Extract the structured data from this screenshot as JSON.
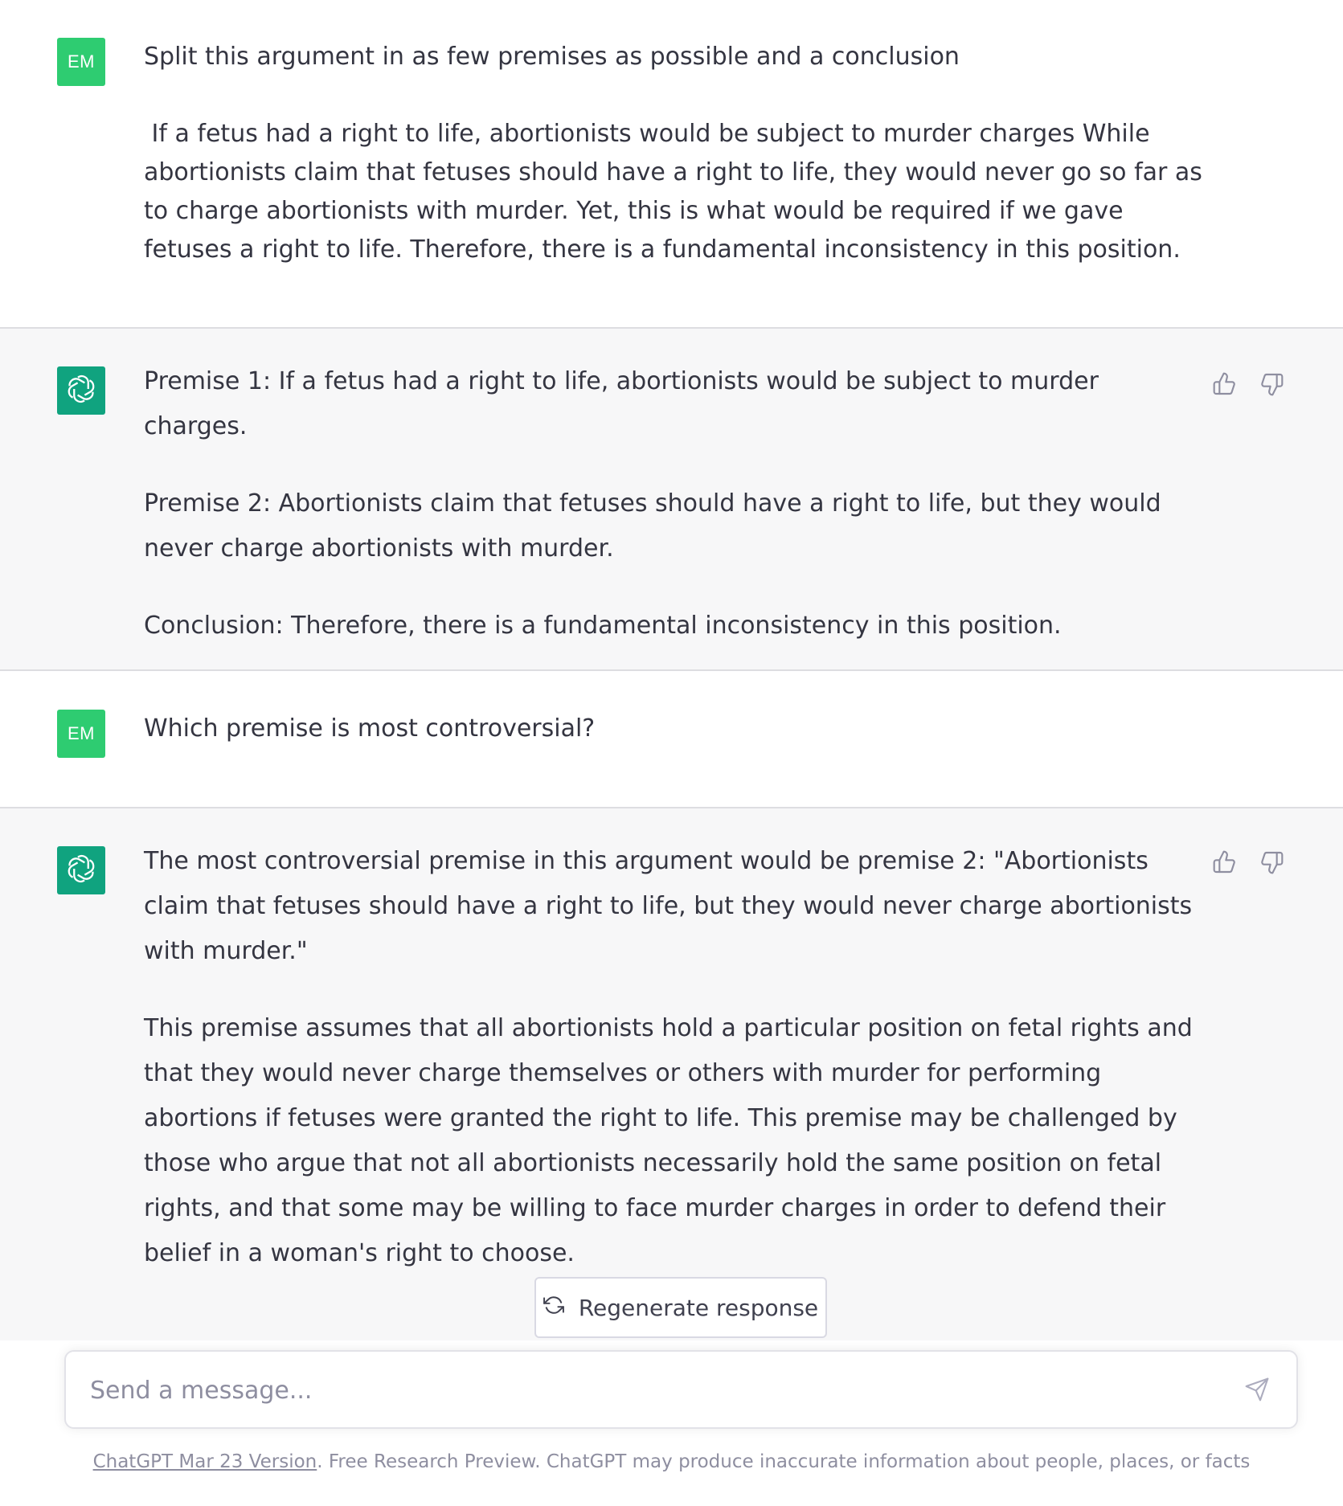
{
  "conversation": {
    "user_avatar_initials": "EM",
    "turns": [
      {
        "role": "user",
        "paragraphs": [
          "Split this argument in as few premises as possible and a conclusion",
          " If a fetus had a right to life, abortionists would be subject to murder charges While abortionists claim that fetuses should have a right to life, they would never go so far as to charge abortionists with murder. Yet, this is what would be required if we gave fetuses a right to life. Therefore, there is a fundamental inconsistency in this position."
        ]
      },
      {
        "role": "assistant",
        "paragraphs": [
          "Premise 1: If a fetus had a right to life, abortionists would be subject to murder charges.",
          "Premise 2: Abortionists claim that fetuses should have a right to life, but they would never charge abortionists with murder.",
          "Conclusion: Therefore, there is a fundamental inconsistency in this position."
        ]
      },
      {
        "role": "user",
        "paragraphs": [
          "Which premise is most controversial?"
        ]
      },
      {
        "role": "assistant",
        "paragraphs": [
          "The most controversial premise in this argument would be premise 2: \"Abortionists claim that fetuses should have a right to life, but they would never charge abortionists with murder.\"",
          "This premise assumes that all abortionists hold a particular position on fetal rights and that they would never charge themselves or others with murder for performing abortions if fetuses were granted the right to life. This premise may be challenged by those who argue that not all abortionists necessarily hold the same position on fetal rights, and that some may be willing to face murder charges in order to defend their belief in a woman's right to choose."
        ]
      }
    ]
  },
  "actions": {
    "regenerate_label": "Regenerate response"
  },
  "composer": {
    "placeholder": "Send a message..."
  },
  "footer": {
    "version_link": "ChatGPT Mar 23 Version",
    "disclaimer": ". Free Research Preview. ChatGPT may produce inaccurate information about people, places, or facts"
  },
  "icons": {
    "bot_avatar": "openai-logo-icon",
    "thumbs_up": "thumbs-up-icon",
    "thumbs_down": "thumbs-down-icon",
    "regenerate": "refresh-icon",
    "send": "send-icon"
  },
  "colors": {
    "user_avatar": "#2ecc71",
    "bot_avatar": "#10a37f",
    "assistant_bg": "#f7f7f8",
    "text": "#343541",
    "muted": "#8e8ea0"
  }
}
